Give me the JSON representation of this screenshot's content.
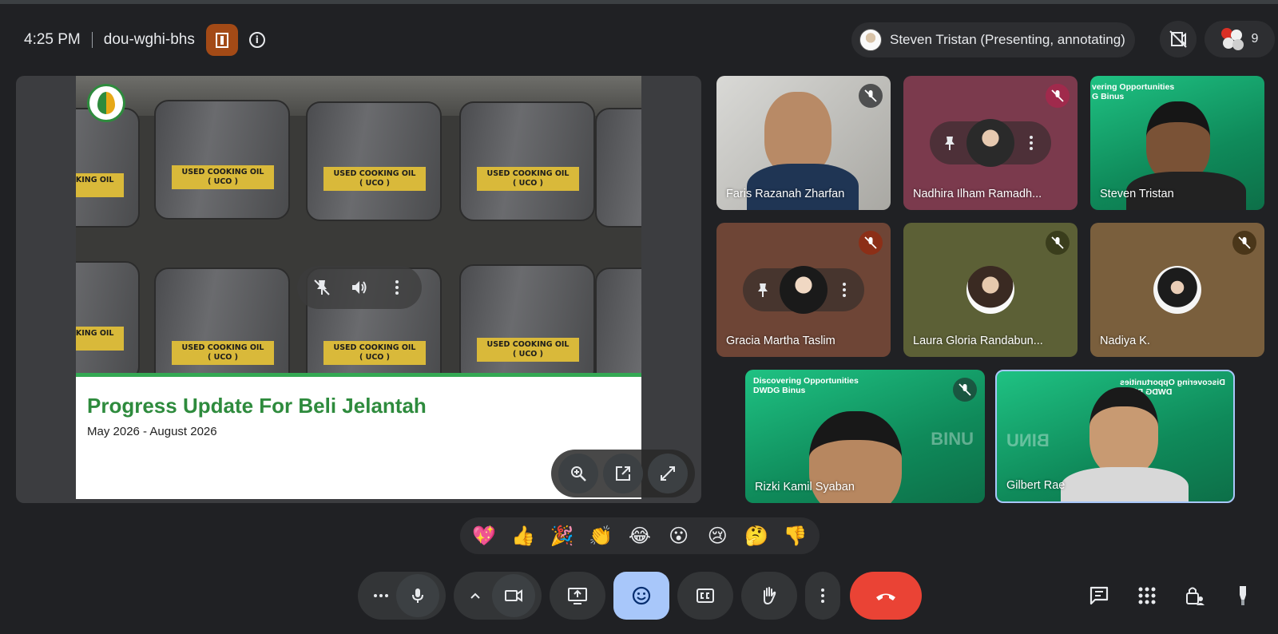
{
  "header": {
    "time": "4:25 PM",
    "meeting_code": "dou-wghi-bhs",
    "presenter_chip": "Steven Tristan (Presenting, annotating)",
    "participant_count": "9"
  },
  "slide": {
    "title": "Progress Update For Beli Jelantah",
    "subtitle": "May 2026 - August 2026",
    "label_line1": "USED COOKING OIL",
    "label_line2": "( UCO )"
  },
  "participants": [
    {
      "name": "Faris Razanah Zharfan"
    },
    {
      "name": "Nadhira Ilham Ramadh..."
    },
    {
      "name": "Steven Tristan",
      "banner": "vering Opportunities\nG Binus"
    },
    {
      "name": "Gracia Martha Taslim"
    },
    {
      "name": "Laura Gloria Randabun..."
    },
    {
      "name": "Nadiya K."
    },
    {
      "name": "Rizki Kamil Syaban",
      "banner": "Discovering Opportunities\nDWDG Binus",
      "bg_text": "BINU"
    },
    {
      "name": "Gilbert Rae",
      "banner": "Discovering Opportunities\nDWDG Binus",
      "bg_text": "BINU"
    }
  ],
  "reactions": [
    "💖",
    "👍",
    "🎉",
    "👏",
    "😂",
    "😮",
    "😢",
    "🤔",
    "👎"
  ],
  "colors": {
    "background": "#202124",
    "end_call": "#ea4335",
    "active_control": "#a8c7fa",
    "slide_green": "#2e8b3d"
  },
  "icons": {
    "more": "more-horiz-icon",
    "mic": "mic-icon",
    "camera": "videocam-icon",
    "present": "present-screen-icon",
    "emoji": "emoji-icon",
    "captions": "closed-caption-icon",
    "raise_hand": "raise-hand-icon",
    "end_call": "call-end-icon",
    "chat": "chat-icon",
    "activities": "apps-grid-icon",
    "host_controls": "lock-person-icon"
  }
}
